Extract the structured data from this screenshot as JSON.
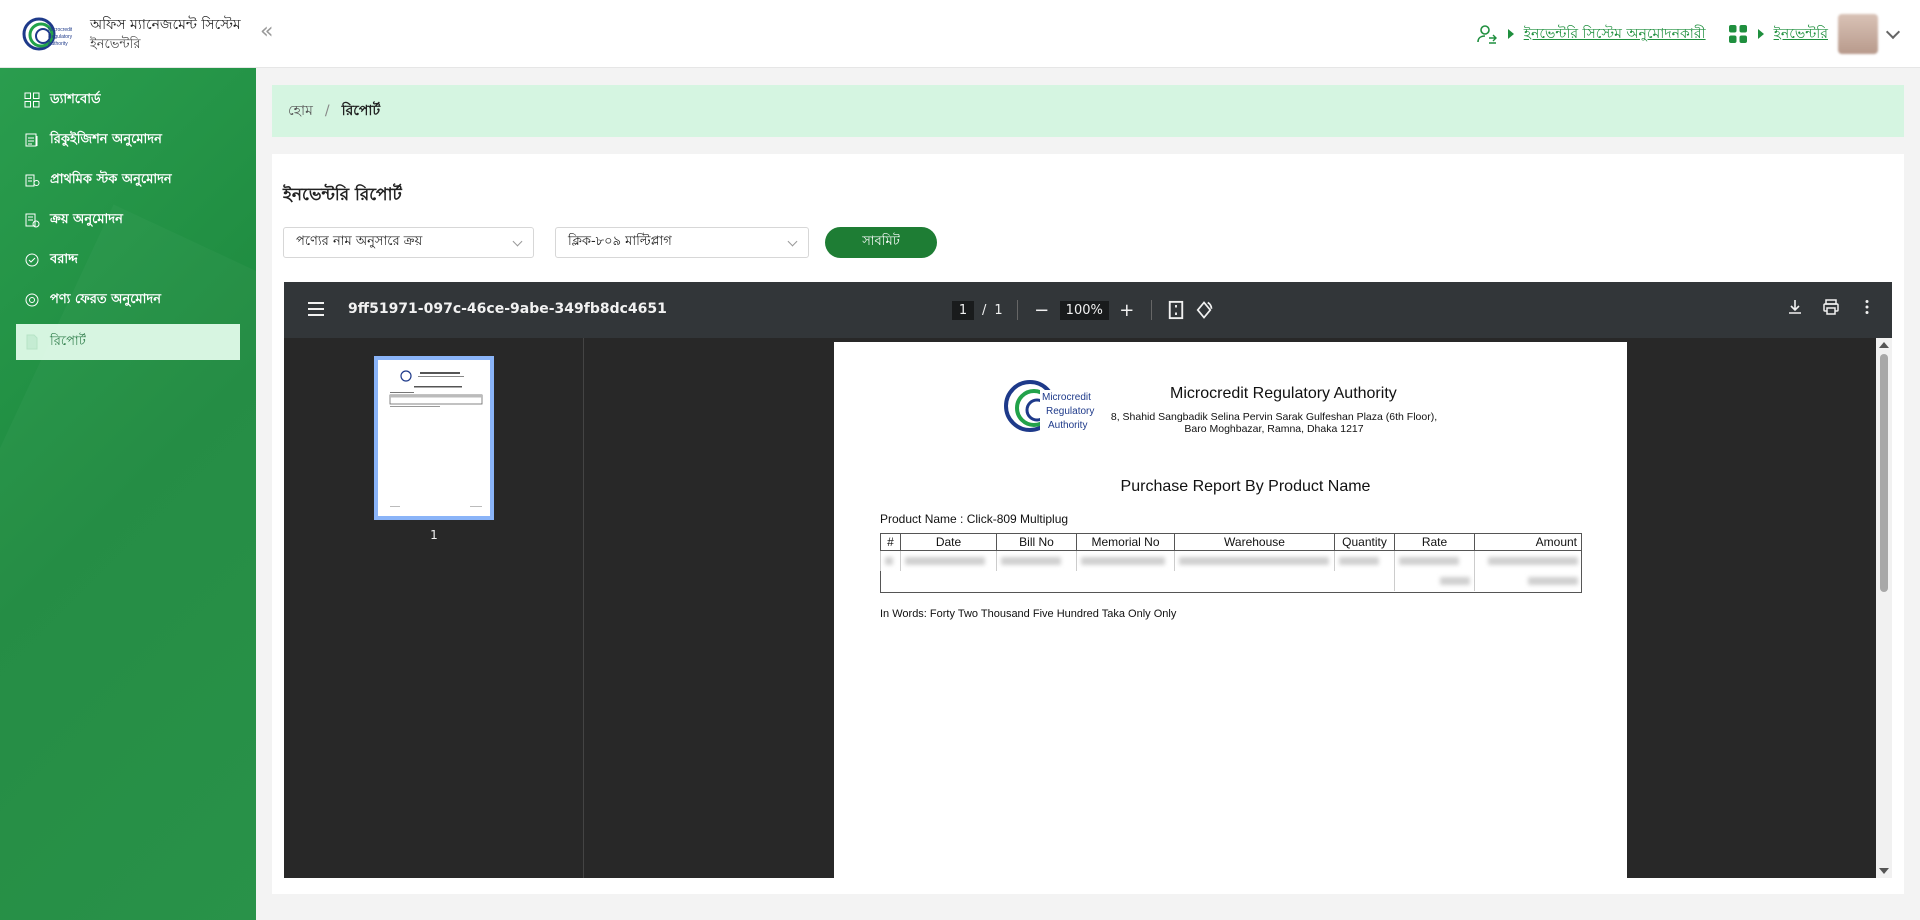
{
  "header": {
    "app_title": "অফিস ম্যানেজমেন্ট সিস্টেম",
    "module": "ইনভেন্টরি",
    "role_link": "ইনভেন্টরি সিস্টেম অনুমোদনকারী",
    "module_link": "ইনভেন্টরি",
    "collapse_glyph": "«"
  },
  "logo": {
    "lines": [
      "Microcredit",
      "Regulatory",
      "Authority"
    ]
  },
  "sidebar": {
    "items": [
      {
        "label": "ড্যাশবোর্ড",
        "icon": "dashboard-icon"
      },
      {
        "label": "রিকুইজিশন অনুমোদন",
        "icon": "requisition-icon"
      },
      {
        "label": "প্রাথমিক স্টক অনুমোদন",
        "icon": "stock-icon"
      },
      {
        "label": "ক্রয় অনুমোদন",
        "icon": "purchase-icon"
      },
      {
        "label": "বরাদ্দ",
        "icon": "allocation-icon"
      },
      {
        "label": "পণ্য ফেরত অনুমোদন",
        "icon": "return-icon"
      },
      {
        "label": "রিপোর্ট",
        "icon": "report-icon"
      }
    ],
    "active_index": 6
  },
  "breadcrumb": {
    "home": "হোম",
    "separator": "/",
    "current": "রিপোর্ট"
  },
  "form": {
    "title": "ইনভেন্টরি রিপোর্ট",
    "report_type": "পণ্যের নাম অনুসারে ক্রয়",
    "product": "ক্লিক-৮০৯ মাল্টিপ্লাগ",
    "submit_label": "সাবমিট"
  },
  "viewer": {
    "file_name": "9ff51971-097c-46ce-9abe-349fb8dc4651",
    "current_page": "1",
    "page_sep": "/",
    "total_pages": "1",
    "zoom": "100%",
    "zoom_out": "−",
    "zoom_in": "+",
    "thumb_label": "1"
  },
  "pdf": {
    "org_name": "Microcredit Regulatory Authority",
    "address_line1": "8, Shahid Sangbadik Selina Pervin Sarak Gulfeshan Plaza (6th Floor),",
    "address_line2": "Baro Moghbazar, Ramna, Dhaka 1217",
    "report_title": "Purchase Report By Product Name",
    "product_line": "Product Name : Click-809 Multiplug",
    "columns": [
      "#",
      "Date",
      "Bill No",
      "Memorial No",
      "Warehouse",
      "Quantity",
      "Rate",
      "Amount"
    ],
    "in_words": "In Words: Forty Two Thousand Five Hundred Taka Only Only"
  },
  "colors": {
    "brand_green": "#1f8f3e",
    "sidebar_active_bg": "#d6f5e0",
    "breadcrumb_bg": "#d5f5e1",
    "submit_bg": "#1e7d34"
  }
}
